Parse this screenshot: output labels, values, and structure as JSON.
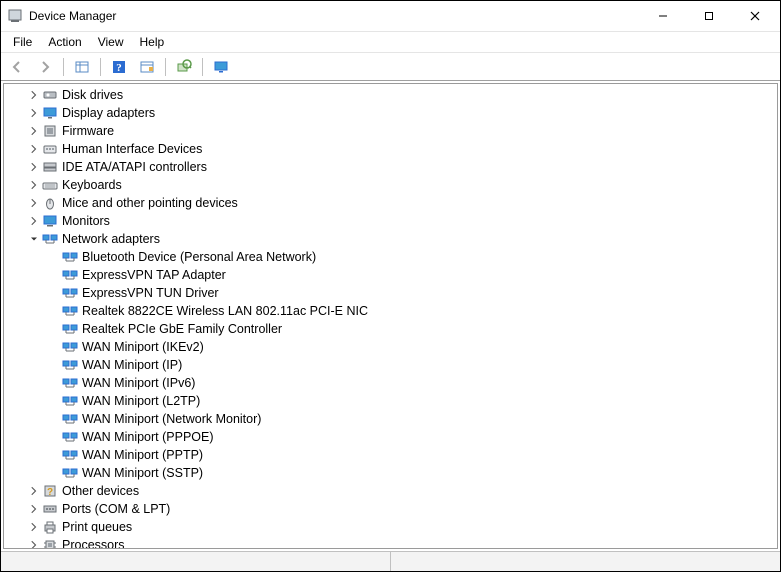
{
  "window": {
    "title": "Device Manager"
  },
  "menu": {
    "file": "File",
    "action": "Action",
    "view": "View",
    "help": "Help"
  },
  "toolbar": {
    "back": "Back",
    "forward": "Forward",
    "list": "Show hidden devices",
    "help": "Help",
    "properties": "Properties",
    "update": "Scan for hardware changes",
    "monitor": "View"
  },
  "tree": [
    {
      "level": 1,
      "expandable": true,
      "expanded": false,
      "icon": "disk-icon",
      "label": "Disk drives"
    },
    {
      "level": 1,
      "expandable": true,
      "expanded": false,
      "icon": "display-icon",
      "label": "Display adapters"
    },
    {
      "level": 1,
      "expandable": true,
      "expanded": false,
      "icon": "firmware-icon",
      "label": "Firmware"
    },
    {
      "level": 1,
      "expandable": true,
      "expanded": false,
      "icon": "hid-icon",
      "label": "Human Interface Devices"
    },
    {
      "level": 1,
      "expandable": true,
      "expanded": false,
      "icon": "ide-icon",
      "label": "IDE ATA/ATAPI controllers"
    },
    {
      "level": 1,
      "expandable": true,
      "expanded": false,
      "icon": "keyboard-icon",
      "label": "Keyboards"
    },
    {
      "level": 1,
      "expandable": true,
      "expanded": false,
      "icon": "mouse-icon",
      "label": "Mice and other pointing devices"
    },
    {
      "level": 1,
      "expandable": true,
      "expanded": false,
      "icon": "monitor-icon",
      "label": "Monitors"
    },
    {
      "level": 1,
      "expandable": true,
      "expanded": true,
      "icon": "network-icon",
      "label": "Network adapters"
    },
    {
      "level": 2,
      "expandable": false,
      "icon": "network-icon",
      "label": "Bluetooth Device (Personal Area Network)"
    },
    {
      "level": 2,
      "expandable": false,
      "icon": "network-icon",
      "label": "ExpressVPN TAP Adapter"
    },
    {
      "level": 2,
      "expandable": false,
      "icon": "network-icon",
      "label": "ExpressVPN TUN Driver"
    },
    {
      "level": 2,
      "expandable": false,
      "icon": "network-icon",
      "label": "Realtek 8822CE Wireless LAN 802.11ac PCI-E NIC"
    },
    {
      "level": 2,
      "expandable": false,
      "icon": "network-icon",
      "label": "Realtek PCIe GbE Family Controller"
    },
    {
      "level": 2,
      "expandable": false,
      "icon": "network-icon",
      "label": "WAN Miniport (IKEv2)"
    },
    {
      "level": 2,
      "expandable": false,
      "icon": "network-icon",
      "label": "WAN Miniport (IP)"
    },
    {
      "level": 2,
      "expandable": false,
      "icon": "network-icon",
      "label": "WAN Miniport (IPv6)"
    },
    {
      "level": 2,
      "expandable": false,
      "icon": "network-icon",
      "label": "WAN Miniport (L2TP)"
    },
    {
      "level": 2,
      "expandable": false,
      "icon": "network-icon",
      "label": "WAN Miniport (Network Monitor)"
    },
    {
      "level": 2,
      "expandable": false,
      "icon": "network-icon",
      "label": "WAN Miniport (PPPOE)"
    },
    {
      "level": 2,
      "expandable": false,
      "icon": "network-icon",
      "label": "WAN Miniport (PPTP)"
    },
    {
      "level": 2,
      "expandable": false,
      "icon": "network-icon",
      "label": "WAN Miniport (SSTP)"
    },
    {
      "level": 1,
      "expandable": true,
      "expanded": false,
      "icon": "other-icon",
      "label": "Other devices"
    },
    {
      "level": 1,
      "expandable": true,
      "expanded": false,
      "icon": "ports-icon",
      "label": "Ports (COM & LPT)"
    },
    {
      "level": 1,
      "expandable": true,
      "expanded": false,
      "icon": "printer-icon",
      "label": "Print queues"
    },
    {
      "level": 1,
      "expandable": true,
      "expanded": false,
      "icon": "cpu-icon",
      "label": "Processors"
    }
  ]
}
